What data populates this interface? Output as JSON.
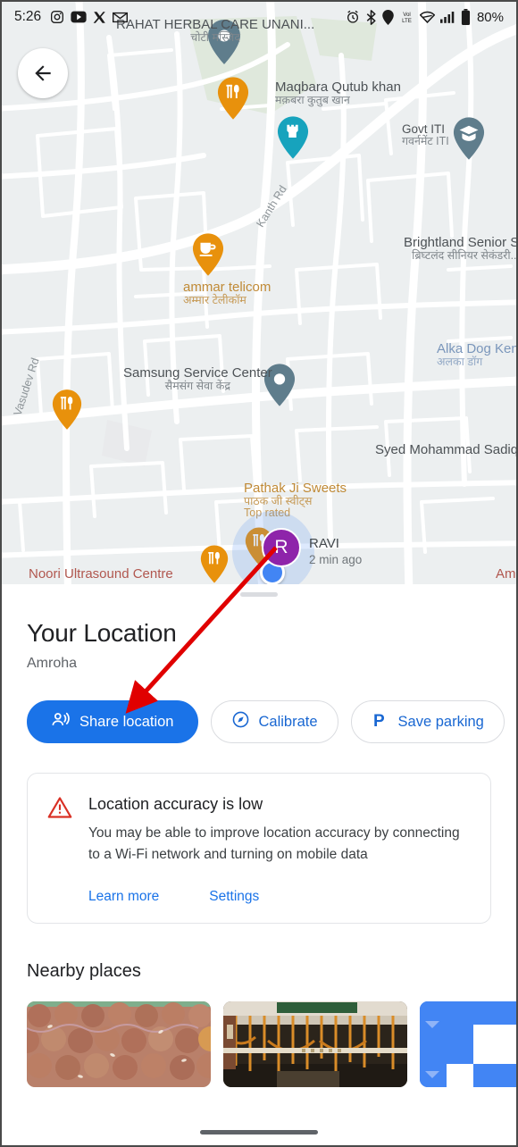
{
  "statusbar": {
    "time": "5:26",
    "battery_percent": "80%",
    "left_icons": [
      "instagram-icon",
      "youtube-icon",
      "twitter-icon",
      "gmail-icon"
    ],
    "right_icons": [
      "alarm-icon",
      "bluetooth-icon",
      "location-icon",
      "volte-icon",
      "wifi-icon",
      "signal-icon",
      "battery-icon"
    ]
  },
  "map": {
    "back_button": "back-arrow",
    "pois": [
      {
        "name": "RAHAT HERBAL CARE UNANI...",
        "sub": "चोटी मस्जिद",
        "style": "dark"
      },
      {
        "name": "Maqbara Qutub khan",
        "sub": "मक़बरा कुतुब खान",
        "style": "dark"
      },
      {
        "name": "Govt ITI",
        "sub": "गवर्नमेंट ITI",
        "style": "dark"
      },
      {
        "name": "ammar telicom",
        "sub": "अम्मार टेलीकॉम",
        "style": "orange"
      },
      {
        "name": "Brightland Senior Secondary School...",
        "sub": "ब्रिघ्टलंद सीनियर सेकंडरी...",
        "style": "dark"
      },
      {
        "name": "Alka Dog Ken",
        "sub": "अलका डॉग",
        "style": "blue"
      },
      {
        "name": "Samsung Service Center",
        "sub": "सैमसंग सेवा केंद्र",
        "style": "dark"
      },
      {
        "name": "Syed Mohammad Sadiq Ali Kha",
        "sub": "",
        "style": "dark"
      },
      {
        "name": "Pathak Ji Sweets",
        "sub": "पाठक जी स्वीट्स",
        "note": "Top rated",
        "style": "orange"
      },
      {
        "name": "Noori Ultrasound Centre",
        "sub": "",
        "style": "red"
      },
      {
        "name": "Am",
        "sub": "",
        "style": "red"
      }
    ],
    "roads": [
      "Kanth Rd",
      "Vasudev Rd"
    ],
    "user": {
      "avatar_initial": "R",
      "name": "RAVI",
      "updated": "2 min ago",
      "avatar_color": "#8e24aa",
      "dot_color": "#4285f4"
    }
  },
  "sheet": {
    "title": "Your Location",
    "subtitle": "Amroha",
    "chips": [
      {
        "label": "Share location",
        "icon": "share-location-icon",
        "primary": true
      },
      {
        "label": "Calibrate",
        "icon": "compass-icon",
        "primary": false
      },
      {
        "label": "Save parking",
        "icon": "parking-icon",
        "primary": false
      },
      {
        "label": "",
        "icon": "feedback-icon",
        "primary": false
      }
    ],
    "accuracy_card": {
      "icon": "warning-triangle-icon",
      "title": "Location accuracy is low",
      "description": "You may be able to improve location accuracy by connecting to a Wi-Fi network and turning on mobile data",
      "learn_more": "Learn more",
      "settings": "Settings"
    },
    "nearby": {
      "title": "Nearby places",
      "thumbs": [
        "sweets-photo",
        "decorated-shop-photo",
        "map-tile-photo"
      ]
    }
  },
  "colors": {
    "accent_blue": "#1a73e8",
    "link_blue": "#1967d2",
    "warning_red": "#d93025",
    "avatar_purple": "#8e24aa",
    "annotation_red": "#e00000"
  }
}
